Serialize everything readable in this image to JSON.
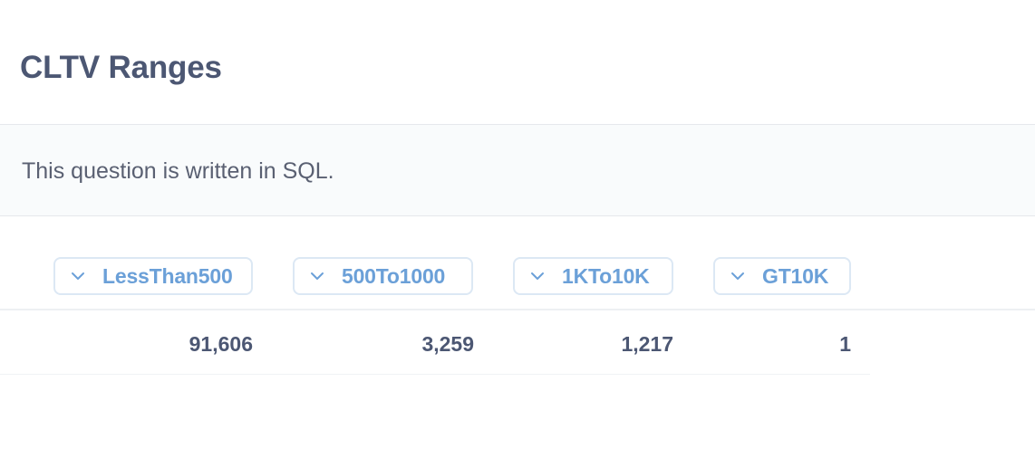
{
  "card": {
    "title": "CLTV Ranges"
  },
  "notice": {
    "text": "This question is written in SQL."
  },
  "table": {
    "columns": [
      {
        "label": "LessThan500",
        "icon": "chevron-down-icon"
      },
      {
        "label": "500To1000",
        "icon": "chevron-down-icon"
      },
      {
        "label": "1KTo10K",
        "icon": "chevron-down-icon"
      },
      {
        "label": "GT10K",
        "icon": "chevron-down-icon"
      }
    ],
    "rows": [
      [
        "91,606",
        "3,259",
        "1,217",
        "1"
      ]
    ]
  },
  "colors": {
    "title": "#4c5773",
    "accent": "#6ba0d8",
    "pill_border": "#dce8f4",
    "notice_bg": "#f9fbfc"
  }
}
